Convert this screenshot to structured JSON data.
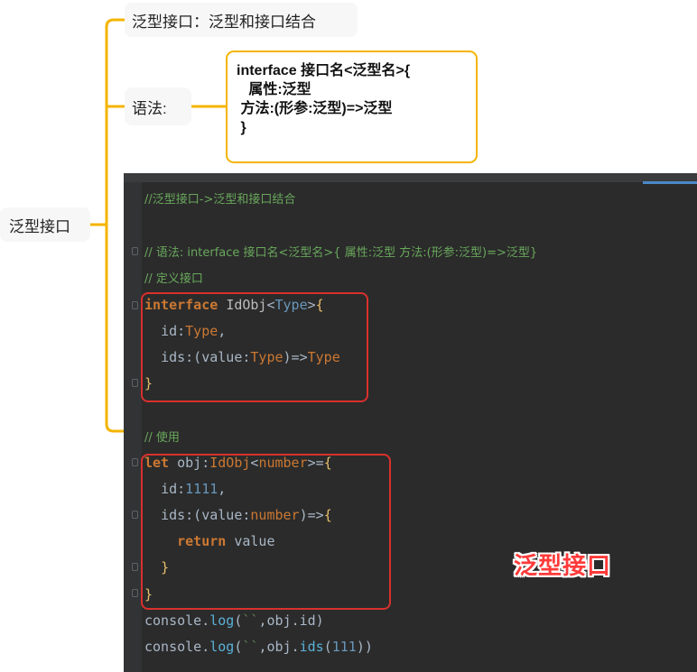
{
  "mindmap": {
    "root": "泛型接口",
    "desc": "泛型接口：泛型和接口结合",
    "syntax_label": "语法:",
    "syntax_lines": [
      "interface 接口名<泛型名>{",
      "   属性:泛型",
      " 方法:(形参:泛型)=>泛型",
      " }"
    ]
  },
  "code": {
    "l1": "//泛型接口->泛型和接口结合",
    "l2": "// 语法: interface 接口名<泛型名>{ 属性:泛型 方法:(形参:泛型)=>泛型}",
    "l3": "// 定义接口",
    "l9": "// 使用",
    "label": "泛型接口"
  },
  "colors": {
    "accent": "#f4b400",
    "editor_bg": "#2b2b2b",
    "highlight_box": "#d9302c"
  }
}
